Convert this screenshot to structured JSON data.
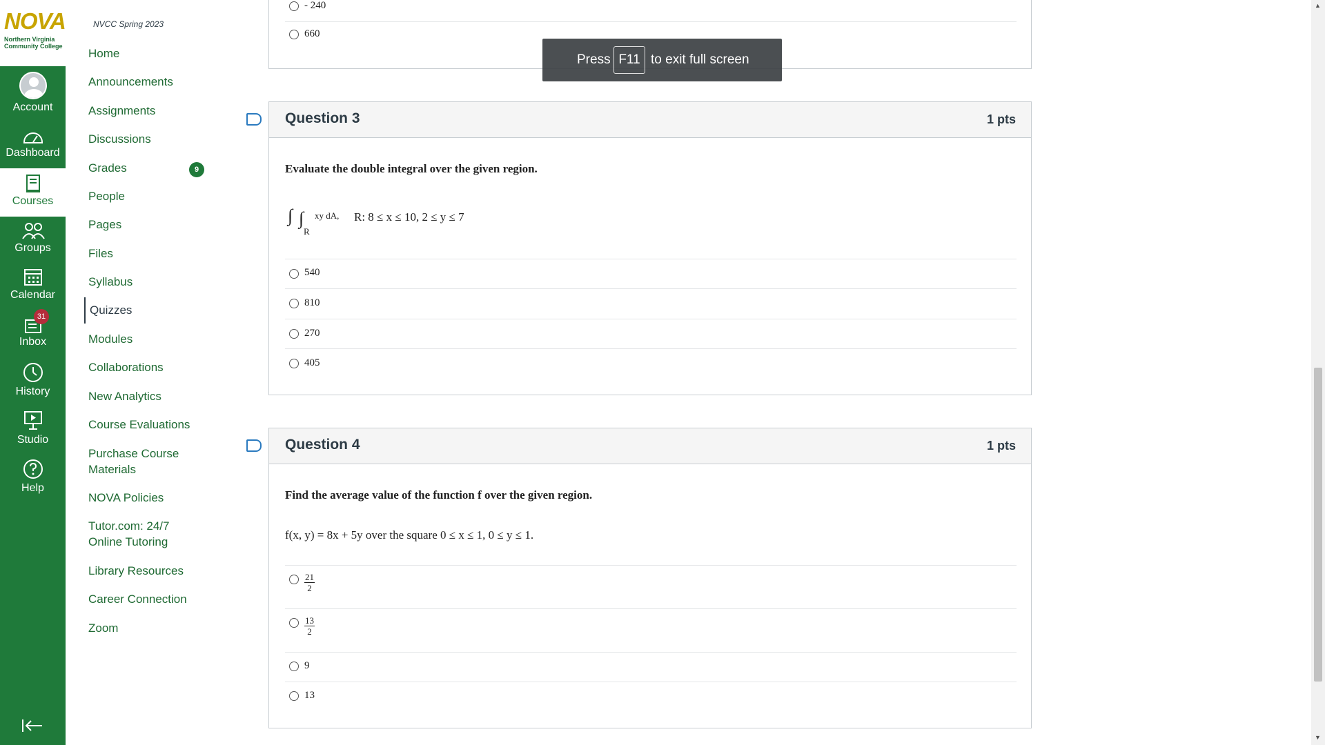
{
  "logo": {
    "name": "NOVA",
    "subtitle": "Northern Virginia Community College"
  },
  "global_nav": {
    "items": [
      {
        "label": "Account",
        "icon": "user-avatar-icon"
      },
      {
        "label": "Dashboard",
        "icon": "dashboard-icon"
      },
      {
        "label": "Courses",
        "icon": "courses-icon"
      },
      {
        "label": "Groups",
        "icon": "groups-icon"
      },
      {
        "label": "Calendar",
        "icon": "calendar-icon"
      },
      {
        "label": "Inbox",
        "icon": "inbox-icon"
      },
      {
        "label": "History",
        "icon": "clock-icon"
      },
      {
        "label": "Studio",
        "icon": "studio-icon"
      },
      {
        "label": "Help",
        "icon": "help-icon"
      }
    ],
    "inbox_count": "31",
    "active": "Courses",
    "collapse_icon": "collapse-arrow-icon"
  },
  "course_nav": {
    "term": "NVCC Spring 2023",
    "items": [
      "Home",
      "Announcements",
      "Assignments",
      "Discussions",
      "Grades",
      "People",
      "Pages",
      "Files",
      "Syllabus",
      "Quizzes",
      "Modules",
      "Collaborations",
      "New Analytics",
      "Course Evaluations",
      "Purchase Course Materials",
      "NOVA Policies",
      "Tutor.com: 24/7 Online Tutoring",
      "Library Resources",
      "Career Connection",
      "Zoom"
    ],
    "active": "Quizzes",
    "grades_badge": "9"
  },
  "fullscreen_toast": {
    "press": "Press",
    "key": "F11",
    "rest": "to exit full screen"
  },
  "previous_question": {
    "answers": [
      "- 240",
      "660"
    ]
  },
  "questions": [
    {
      "title": "Question 3",
      "points": "1 pts",
      "prompt": "Evaluate the double integral over the given region.",
      "expression": {
        "integrand": "xy dA,",
        "region_sub": "R",
        "region": "R: 8 ≤ x ≤ 10, 2 ≤ y ≤ 7"
      },
      "answers": [
        "540",
        "810",
        "270",
        "405"
      ]
    },
    {
      "title": "Question 4",
      "points": "1 pts",
      "prompt": "Find the average value of the function f over the given region.",
      "expression": "f(x, y) = 8x + 5y over the square 0 ≤ x ≤ 1, 0 ≤ y ≤ 1.",
      "answers": [
        {
          "num": "21",
          "den": "2"
        },
        {
          "num": "13",
          "den": "2"
        },
        {
          "text": "9"
        },
        {
          "text": "13"
        }
      ]
    }
  ],
  "colors": {
    "nav_green": "#1f7a3a",
    "link_green": "#1f6a33",
    "logo_gold": "#c8a400",
    "badge_red": "#b52d3b",
    "flag_blue": "#2a7abf"
  }
}
